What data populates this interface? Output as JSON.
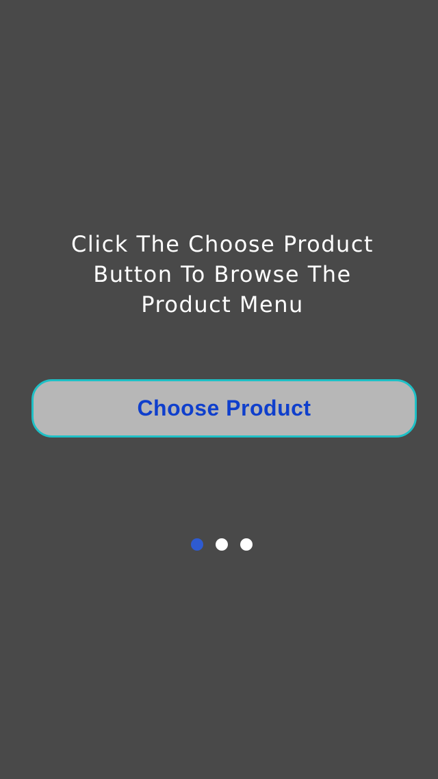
{
  "onboarding": {
    "instruction": "Click The Choose Product\nButton To Browse The\nProduct Menu",
    "button_label": "Choose Product",
    "pager": {
      "total_pages": 3,
      "current_page": 1
    }
  },
  "colors": {
    "background": "#494949",
    "button_fill": "#b7b7b7",
    "button_border": "#1ec0c6",
    "button_text": "#0f3fcc",
    "dot_active": "#2e5bd1",
    "dot_inactive": "#ffffff"
  }
}
